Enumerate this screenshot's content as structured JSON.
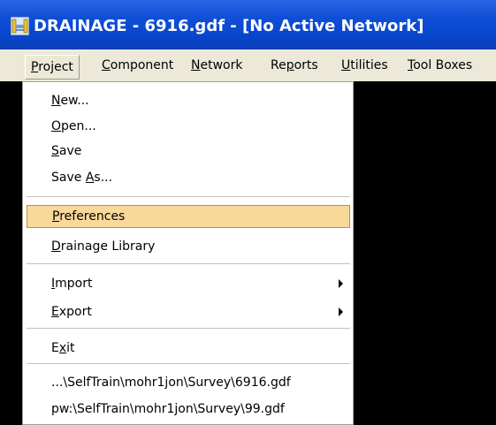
{
  "window": {
    "title": "DRAINAGE - 6916.gdf - [No Active Network]",
    "colors": {
      "titlebar": "#0846cd",
      "menubar": "#ece9d8",
      "workspace": "#000000",
      "highlight": "#f9d99a",
      "highlight_border": "#c88d2e"
    },
    "icon": "drainage-app-icon"
  },
  "menubar": {
    "items": [
      {
        "pre": "",
        "key": "P",
        "post": "roject",
        "active": true
      },
      {
        "pre": "",
        "key": "C",
        "post": "omponent"
      },
      {
        "pre": "",
        "key": "N",
        "post": "etwork"
      },
      {
        "pre": "Re",
        "key": "p",
        "post": "orts"
      },
      {
        "pre": "",
        "key": "U",
        "post": "tilities"
      },
      {
        "pre": "",
        "key": "T",
        "post": "ool Boxes"
      }
    ]
  },
  "project_menu": {
    "items": [
      {
        "pre": "",
        "key": "N",
        "post": "ew..."
      },
      {
        "pre": "",
        "key": "O",
        "post": "pen..."
      },
      {
        "pre": "",
        "key": "S",
        "post": "ave"
      },
      {
        "pre": "Save ",
        "key": "A",
        "post": "s..."
      },
      {
        "pre": "",
        "key": "P",
        "post": "references",
        "highlighted": true
      },
      {
        "pre": "",
        "key": "D",
        "post": "rainage Library"
      },
      {
        "pre": "",
        "key": "I",
        "post": "mport",
        "submenu": true
      },
      {
        "pre": "",
        "key": "E",
        "post": "xport",
        "submenu": true
      },
      {
        "pre": "E",
        "key": "x",
        "post": "it"
      },
      {
        "pre": "...\\SelfTrain\\mohr1jon\\Survey\\6916.gdf",
        "key": "",
        "post": ""
      },
      {
        "pre": "pw:\\SelfTrain\\mohr1jon\\Survey\\99.gdf",
        "key": "",
        "post": ""
      }
    ]
  }
}
